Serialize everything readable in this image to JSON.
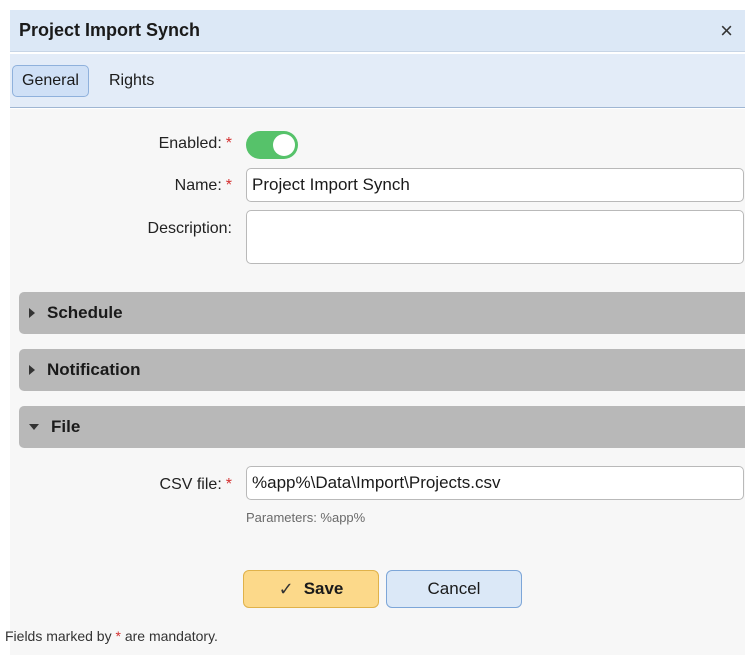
{
  "dialog": {
    "title": "Project Import Synch",
    "close_icon": "×"
  },
  "tabs": [
    {
      "label": "General",
      "active": true
    },
    {
      "label": "Rights",
      "active": false
    }
  ],
  "form": {
    "enabled": {
      "label": "Enabled:",
      "required_mark": "*",
      "value": true
    },
    "name": {
      "label": "Name:",
      "required_mark": "*",
      "value": "Project Import Synch"
    },
    "description": {
      "label": "Description:",
      "value": ""
    }
  },
  "sections": [
    {
      "label": "Schedule",
      "expanded": false
    },
    {
      "label": "Notification",
      "expanded": false
    },
    {
      "label": "File",
      "expanded": true
    }
  ],
  "file": {
    "csv_label": "CSV file:",
    "required_mark": "*",
    "csv_value": "%app%\\Data\\Import\\Projects.csv",
    "hint": "Parameters: %app%"
  },
  "buttons": {
    "save_icon": "✓",
    "save": "Save",
    "cancel": "Cancel"
  },
  "footer": {
    "before": "Fields marked by",
    "mark": "*",
    "after": "are mandatory."
  },
  "colors": {
    "toggle_on": "#56c26a",
    "save_bg": "#fcd98a",
    "cancel_bg": "#dbe8f7",
    "required": "#d32f2f"
  }
}
